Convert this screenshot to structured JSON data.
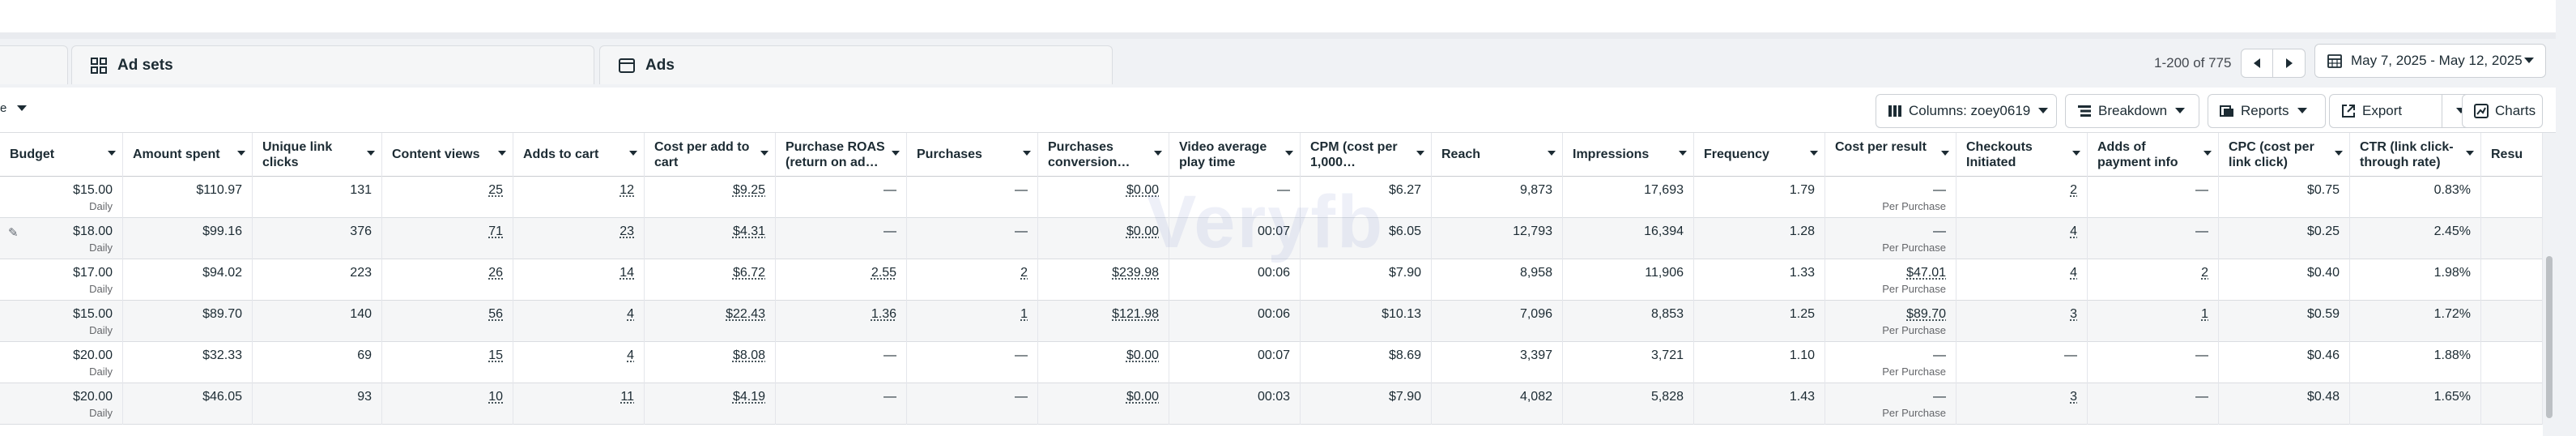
{
  "tabs": {
    "ad_sets": "Ad sets",
    "ads": "Ads"
  },
  "pager": {
    "range": "1-200 of 775"
  },
  "date_range": "May 7, 2025 - May 12, 2025",
  "toolbar": {
    "partial_label": "e",
    "columns": "Columns: zoey0619",
    "breakdown": "Breakdown",
    "reports": "Reports",
    "export": "Export",
    "charts": "Charts"
  },
  "columns": [
    {
      "label": "Budget"
    },
    {
      "label": "Amount spent"
    },
    {
      "label": "Unique link clicks"
    },
    {
      "label": "Content views"
    },
    {
      "label": "Adds to cart"
    },
    {
      "label": "Cost per add to cart"
    },
    {
      "label": "Purchase ROAS (return on ad…"
    },
    {
      "label": "Purchases"
    },
    {
      "label": "Purchases conversion…"
    },
    {
      "label": "Video average play time"
    },
    {
      "label": "CPM (cost per 1,000…"
    },
    {
      "label": "Reach"
    },
    {
      "label": "Impressions"
    },
    {
      "label": "Frequency"
    },
    {
      "label": "Cost per result"
    },
    {
      "label": "Checkouts Initiated"
    },
    {
      "label": "Adds of payment info"
    },
    {
      "label": "CPC (cost per link click)"
    },
    {
      "label": "CTR (link click-through rate)"
    },
    {
      "label": "Resu"
    }
  ],
  "rows": [
    {
      "budget": "$15.00",
      "budget_sub": "Daily",
      "spent": "$110.97",
      "clicks": "131",
      "views": "25",
      "atc": "12",
      "cpatc": "$9.25",
      "roas": "—",
      "purchases": "—",
      "conv": "$0.00",
      "play": "—",
      "cpm": "$6.27",
      "reach": "9,873",
      "impr": "17,693",
      "freq": "1.79",
      "cpr": "—",
      "cpr_sub": "Per Purchase",
      "checkouts": "2",
      "payinfo": "—",
      "cpc": "$0.75",
      "ctr": "0.83%"
    },
    {
      "budget": "$18.00",
      "budget_sub": "Daily",
      "spent": "$99.16",
      "clicks": "376",
      "views": "71",
      "atc": "23",
      "cpatc": "$4.31",
      "roas": "—",
      "purchases": "—",
      "conv": "$0.00",
      "play": "00:07",
      "cpm": "$6.05",
      "reach": "12,793",
      "impr": "16,394",
      "freq": "1.28",
      "cpr": "—",
      "cpr_sub": "Per Purchase",
      "checkouts": "4",
      "payinfo": "—",
      "cpc": "$0.25",
      "ctr": "2.45%"
    },
    {
      "budget": "$17.00",
      "budget_sub": "Daily",
      "spent": "$94.02",
      "clicks": "223",
      "views": "26",
      "atc": "14",
      "cpatc": "$6.72",
      "roas": "2.55",
      "purchases": "2",
      "conv": "$239.98",
      "play": "00:06",
      "cpm": "$7.90",
      "reach": "8,958",
      "impr": "11,906",
      "freq": "1.33",
      "cpr": "$47.01",
      "cpr_sub": "Per Purchase",
      "checkouts": "4",
      "payinfo": "2",
      "cpc": "$0.40",
      "ctr": "1.98%"
    },
    {
      "budget": "$15.00",
      "budget_sub": "Daily",
      "spent": "$89.70",
      "clicks": "140",
      "views": "56",
      "atc": "4",
      "cpatc": "$22.43",
      "roas": "1.36",
      "purchases": "1",
      "conv": "$121.98",
      "play": "00:06",
      "cpm": "$10.13",
      "reach": "7,096",
      "impr": "8,853",
      "freq": "1.25",
      "cpr": "$89.70",
      "cpr_sub": "Per Purchase",
      "checkouts": "3",
      "payinfo": "1",
      "cpc": "$0.59",
      "ctr": "1.72%"
    },
    {
      "budget": "$20.00",
      "budget_sub": "Daily",
      "spent": "$32.33",
      "clicks": "69",
      "views": "15",
      "atc": "4",
      "cpatc": "$8.08",
      "roas": "—",
      "purchases": "—",
      "conv": "$0.00",
      "play": "00:07",
      "cpm": "$8.69",
      "reach": "3,397",
      "impr": "3,721",
      "freq": "1.10",
      "cpr": "—",
      "cpr_sub": "Per Purchase",
      "checkouts": "—",
      "payinfo": "—",
      "cpc": "$0.46",
      "ctr": "1.88%"
    },
    {
      "budget": "$20.00",
      "budget_sub": "Daily",
      "spent": "$46.05",
      "clicks": "93",
      "views": "10",
      "atc": "11",
      "cpatc": "$4.19",
      "roas": "—",
      "purchases": "—",
      "conv": "$0.00",
      "play": "00:03",
      "cpm": "$7.90",
      "reach": "4,082",
      "impr": "5,828",
      "freq": "1.43",
      "cpr": "—",
      "cpr_sub": "Per Purchase",
      "checkouts": "3",
      "payinfo": "—",
      "cpc": "$0.48",
      "ctr": "1.65%"
    }
  ],
  "watermark": "Veryfb"
}
